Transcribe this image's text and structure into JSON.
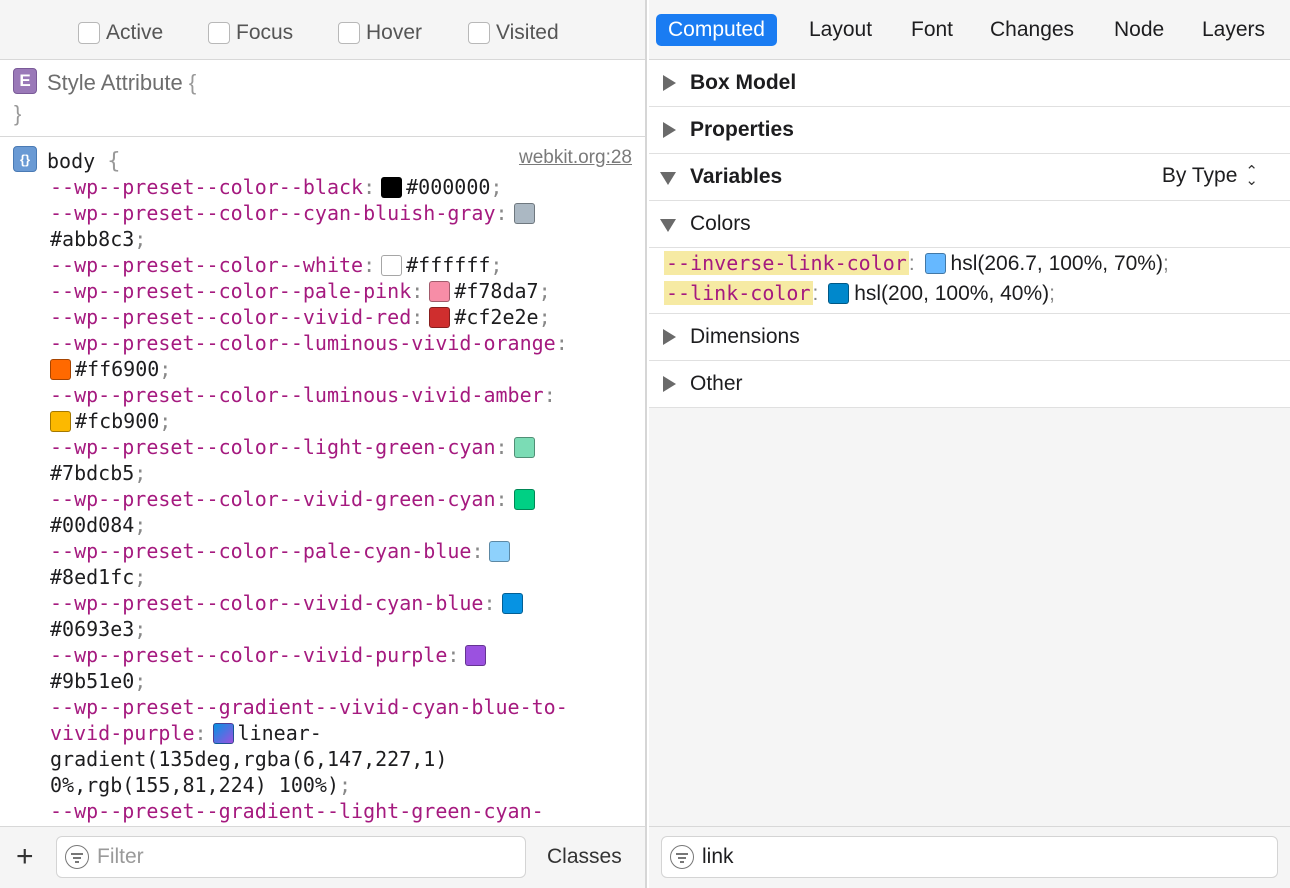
{
  "left_panel": {
    "pseudo_classes": [
      {
        "label": "Active"
      },
      {
        "label": "Focus"
      },
      {
        "label": "Hover"
      },
      {
        "label": "Visited"
      }
    ],
    "style_attribute": {
      "badge": "E",
      "title": "Style Attribute",
      "open_brace": "{",
      "close_brace": "}"
    },
    "rule": {
      "badge": "{}",
      "selector": "body",
      "open_brace": "{",
      "source": "webkit.org:28",
      "declarations": [
        {
          "name": "--wp--preset--color--black",
          "value": "#000000",
          "swatch": "#000000",
          "wrap": false
        },
        {
          "name": "--wp--preset--color--cyan-bluish-gray",
          "value": "#abb8c3",
          "swatch": "#abb8c3",
          "wrap": true
        },
        {
          "name": "--wp--preset--color--white",
          "value": "#ffffff",
          "swatch": "#ffffff",
          "wrap": false
        },
        {
          "name": "--wp--preset--color--pale-pink",
          "value": "#f78da7",
          "swatch": "#f78da7",
          "wrap": false
        },
        {
          "name": "--wp--preset--color--vivid-red",
          "value": "#cf2e2e",
          "swatch": "#cf2e2e",
          "wrap": false
        },
        {
          "name": "--wp--preset--color--luminous-vivid-orange",
          "value": "#ff6900",
          "swatch": "#ff6900",
          "wrap": true,
          "swatch_on_next": true
        },
        {
          "name": "--wp--preset--color--luminous-vivid-amber",
          "value": "#fcb900",
          "swatch": "#fcb900",
          "wrap": true,
          "swatch_on_next": true
        },
        {
          "name": "--wp--preset--color--light-green-cyan",
          "value": "#7bdcb5",
          "swatch": "#7bdcb5",
          "wrap": true
        },
        {
          "name": "--wp--preset--color--vivid-green-cyan",
          "value": "#00d084",
          "swatch": "#00d084",
          "wrap": true
        },
        {
          "name": "--wp--preset--color--pale-cyan-blue",
          "value": "#8ed1fc",
          "swatch": "#8ed1fc",
          "wrap": true
        },
        {
          "name": "--wp--preset--color--vivid-cyan-blue",
          "value": "#0693e3",
          "swatch": "#0693e3",
          "wrap": true
        },
        {
          "name": "--wp--preset--color--vivid-purple",
          "value": "#9b51e0",
          "swatch": "#9b51e0",
          "wrap": true
        }
      ],
      "gradient_decl": {
        "name_line1": "--wp--preset--gradient--vivid-cyan-blue-to-",
        "name_line2": "vivid-purple",
        "value_line1": "linear-",
        "value_line2": "gradient(135deg,rgba(6,147,227,1)",
        "value_line3": "0%,rgb(155,81,224) 100%)",
        "swatch_from": "#0693e3",
        "swatch_to": "#9b51e0"
      },
      "next_partial": "--wp--preset--gradient--light-green-cyan-"
    },
    "filter": {
      "placeholder": "Filter",
      "add_label": "+",
      "classes_label": "Classes"
    }
  },
  "right_panel": {
    "tabs": [
      {
        "label": "Computed",
        "active": true
      },
      {
        "label": "Layout"
      },
      {
        "label": "Font"
      },
      {
        "label": "Changes"
      },
      {
        "label": "Node"
      },
      {
        "label": "Layers"
      }
    ],
    "sections": {
      "box_model": "Box Model",
      "properties": "Properties",
      "variables": "Variables",
      "variables_sort": "By Type",
      "colors": "Colors",
      "dimensions": "Dimensions",
      "other": "Other"
    },
    "variables": [
      {
        "name": "--inverse-link-color",
        "value": "hsl(206.7, 100%, 70%)",
        "swatch": "#66b8ff"
      },
      {
        "name": "--link-color",
        "value": "hsl(200, 100%, 40%)",
        "swatch": "#0088cc"
      }
    ],
    "filter": {
      "value": "link"
    }
  },
  "colors": {
    "accent": "#1a7cf2",
    "property": "#a51a7f",
    "highlight": "#f6eaa3"
  }
}
